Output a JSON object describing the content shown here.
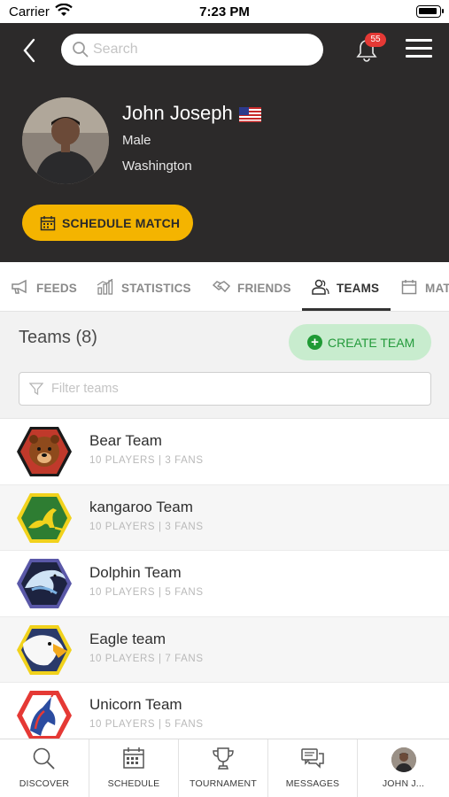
{
  "status_bar": {
    "carrier": "Carrier",
    "time": "7:23 PM"
  },
  "header": {
    "search_placeholder": "Search",
    "notification_count": "55"
  },
  "profile": {
    "name": "John Joseph",
    "gender": "Male",
    "location": "Washington",
    "schedule_button": "SCHEDULE MATCH"
  },
  "tabs": [
    {
      "label": "FEEDS",
      "icon": "megaphone-icon"
    },
    {
      "label": "STATISTICS",
      "icon": "bar-chart-icon"
    },
    {
      "label": "FRIENDS",
      "icon": "handshake-icon"
    },
    {
      "label": "TEAMS",
      "icon": "users-icon",
      "active": true
    },
    {
      "label": "MAT",
      "icon": "calendar-icon"
    }
  ],
  "teams": {
    "title": "Teams (8)",
    "create_button": "CREATE TEAM",
    "filter_placeholder": "Filter teams",
    "items": [
      {
        "name": "Bear Team",
        "meta": "10 PLAYERS | 3 FANS",
        "logo": "bear-logo"
      },
      {
        "name": "kangaroo Team",
        "meta": "10 PLAYERS | 3 FANS",
        "logo": "kangaroo-logo"
      },
      {
        "name": "Dolphin Team",
        "meta": "10 PLAYERS | 5 FANS",
        "logo": "dolphin-logo"
      },
      {
        "name": "Eagle team",
        "meta": "10 PLAYERS | 7 FANS",
        "logo": "eagle-logo"
      },
      {
        "name": "Unicorn Team",
        "meta": "10 PLAYERS | 5 FANS",
        "logo": "unicorn-logo"
      }
    ]
  },
  "bottom_nav": [
    {
      "label": "DISCOVER",
      "icon": "search-icon"
    },
    {
      "label": "SCHEDULE",
      "icon": "calendar-icon"
    },
    {
      "label": "TOURNAMENT",
      "icon": "trophy-icon"
    },
    {
      "label": "MESSAGES",
      "icon": "chat-icon"
    },
    {
      "label": "JOHN J...",
      "icon": "avatar"
    }
  ],
  "colors": {
    "header_bg": "#2c2a2a",
    "accent_yellow": "#f4b400",
    "create_green": "#239a3b",
    "notification_red": "#e53935"
  }
}
